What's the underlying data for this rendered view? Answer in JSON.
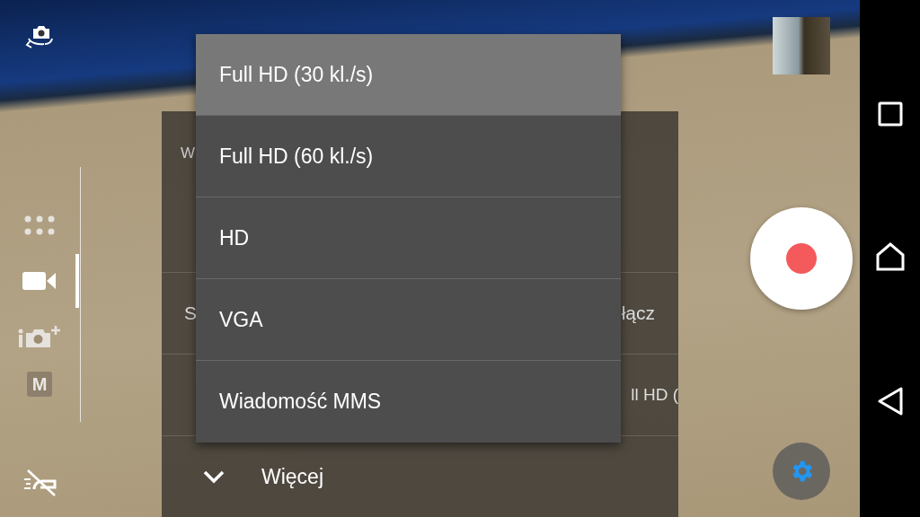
{
  "mode_rail": {
    "modes": [
      {
        "kind": "apps",
        "selected": false,
        "disabled": false
      },
      {
        "kind": "video",
        "selected": true,
        "disabled": false
      },
      {
        "kind": "camera-plus",
        "selected": false,
        "disabled": false
      },
      {
        "kind": "manual",
        "label": "M",
        "selected": false,
        "disabled": true
      }
    ]
  },
  "settings_panel": {
    "title": "W",
    "rows": [
      {
        "label": "S",
        "value": "łącz"
      },
      {
        "value": "ll HD ("
      }
    ],
    "more": {
      "label": "Więcej"
    }
  },
  "resolution_menu": {
    "options": [
      {
        "label": "Full HD (30 kl./s)",
        "selected": true
      },
      {
        "label": "Full HD (60 kl./s)",
        "selected": false
      },
      {
        "label": "HD",
        "selected": false
      },
      {
        "label": "VGA",
        "selected": false
      },
      {
        "label": "Wiadomość MMS",
        "selected": false
      }
    ]
  }
}
